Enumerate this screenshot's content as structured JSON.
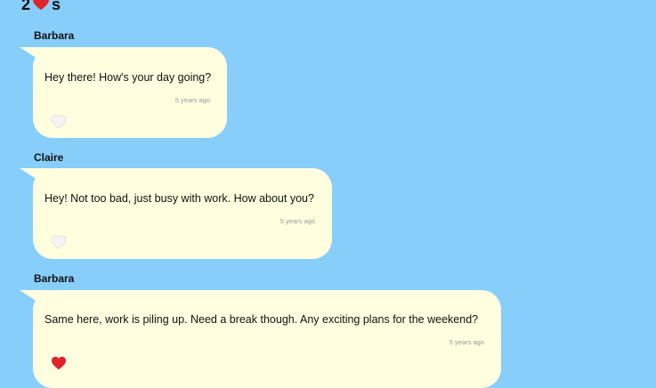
{
  "header": {
    "likes_count": "2",
    "likes_suffix": "s",
    "heart_color": "#e0242a"
  },
  "messages": [
    {
      "sender": "Barbara",
      "text": "Hey there! How's your day going?",
      "timestamp": "5 years ago",
      "liked": false
    },
    {
      "sender": "Claire",
      "text": "Hey! Not too bad, just busy with work. How about you?",
      "timestamp": "5 years ago",
      "liked": false
    },
    {
      "sender": "Barbara",
      "text": "Same here, work is piling up. Need a break though. Any exciting plans for the weekend?",
      "timestamp": "5 years ago",
      "liked": true
    }
  ],
  "colors": {
    "background": "#87cefa",
    "bubble": "#ffffe0",
    "heart_liked": "#e0242a",
    "heart_unliked": "#f0f0f0"
  },
  "icons": {
    "header_heart": "heart-icon",
    "like_button": "heart-icon"
  }
}
